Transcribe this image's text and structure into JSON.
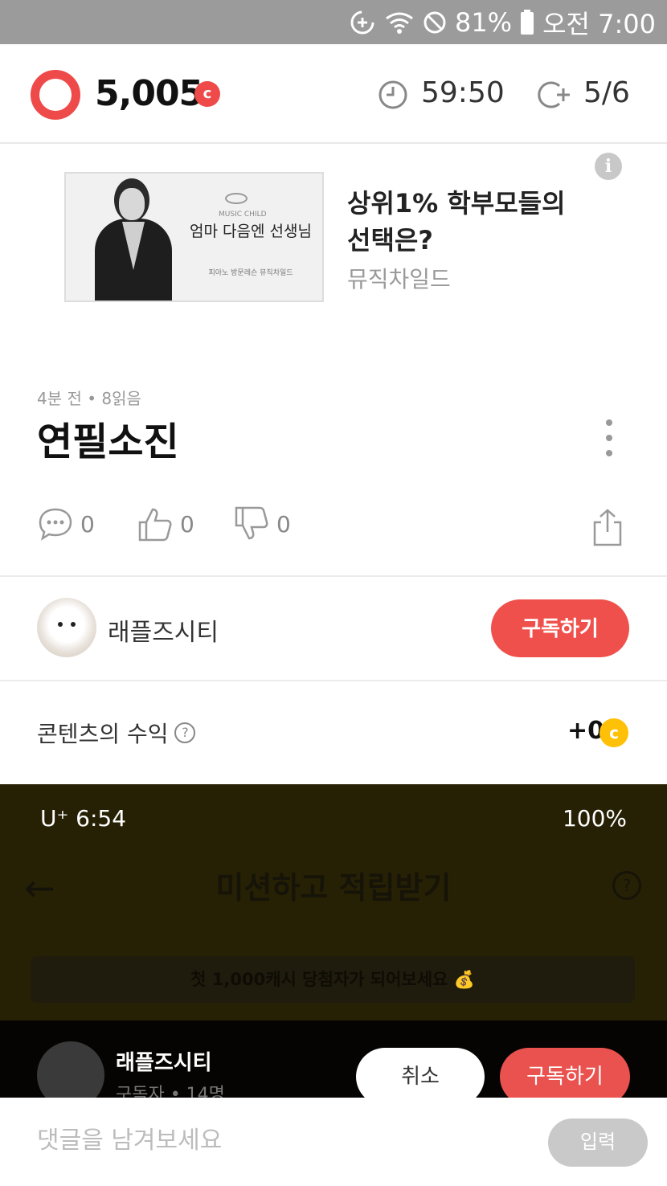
{
  "status_bar": {
    "battery": "81%",
    "time": "오전 7:00"
  },
  "header": {
    "points": "5,005",
    "points_coin_symbol": "c",
    "timer": "59:50",
    "count": "5/6"
  },
  "ad": {
    "title": "상위1% 학부모들의 선택은?",
    "advertiser": "뮤직차일드",
    "image_brand": "MUSIC CHILD",
    "image_slogan": "엄마 다음엔 선생님",
    "image_subtext": "피아노 방문레슨 뮤직차일드"
  },
  "post": {
    "meta": "4분 전 • 8읽음",
    "title": "연필소진",
    "comments_count": "0",
    "likes_count": "0",
    "dislikes_count": "0"
  },
  "author": {
    "name": "래플즈시티",
    "subscribe_label": "구독하기"
  },
  "revenue": {
    "label": "콘텐츠의 수익",
    "help_symbol": "?",
    "value": "+0",
    "coin_symbol": "c"
  },
  "embedded_screenshot": {
    "carrier": "U⁺ 6:54",
    "battery": "100%",
    "title": "미션하고 적립받기",
    "help_symbol": "?",
    "banner": "첫 1,000캐시 당첨자가 되어보세요 💰",
    "popup": {
      "name": "래플즈시티",
      "subtitle": "구독자 • 14명",
      "cancel_label": "취소",
      "subscribe_label": "구독하기"
    }
  },
  "comment_bar": {
    "placeholder": "댓글을 남겨보세요",
    "submit_label": "입력"
  },
  "colors": {
    "accent_red": "#f0504c",
    "coin_yellow": "#ffc107",
    "status_bar_gray": "#9b9b9b"
  }
}
